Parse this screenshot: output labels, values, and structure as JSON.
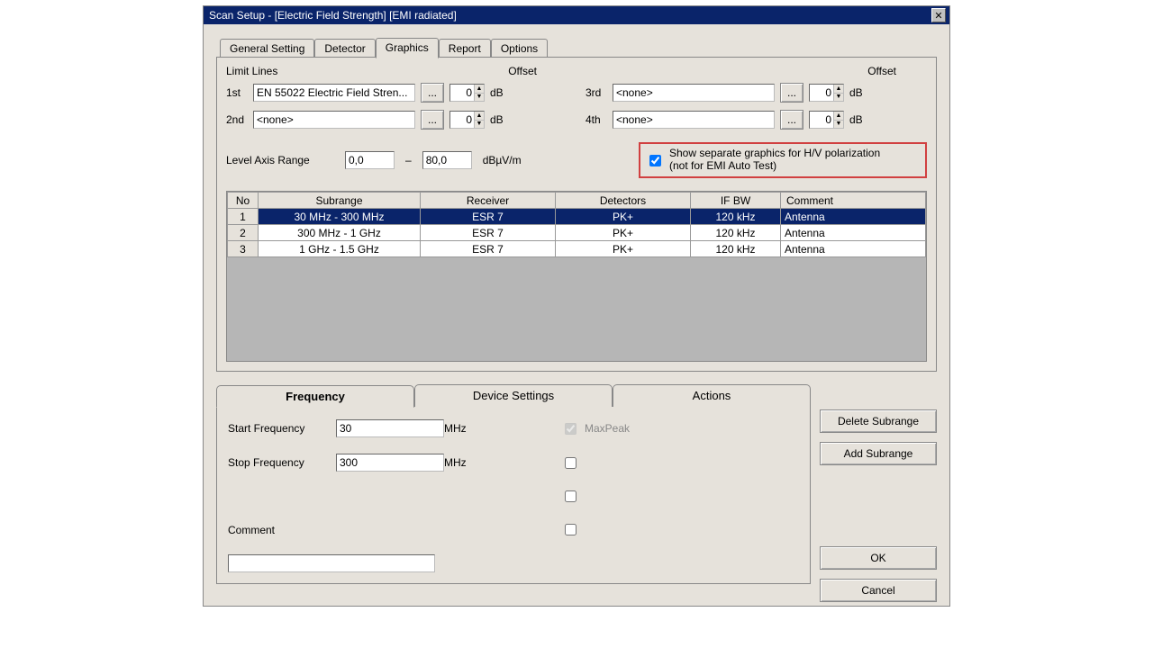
{
  "window": {
    "title": "Scan Setup - [Electric Field Strength] [EMI radiated]"
  },
  "tabs": {
    "general": "General Setting",
    "detector": "Detector",
    "graphics": "Graphics",
    "report": "Report",
    "options": "Options"
  },
  "limits": {
    "section": "Limit Lines",
    "offset_label": "Offset",
    "db": "dB",
    "row1_label": "1st",
    "row1_value": "EN 55022 Electric Field Stren...",
    "row1_offset": "0",
    "row2_label": "2nd",
    "row2_value": "<none>",
    "row2_offset": "0",
    "row3_label": "3rd",
    "row3_value": "<none>",
    "row3_offset": "0",
    "row4_label": "4th",
    "row4_value": "<none>",
    "row4_offset": "0"
  },
  "level_axis": {
    "label": "Level Axis Range",
    "from": "0,0",
    "dash": "–",
    "to": "80,0",
    "unit": "dBµV/m"
  },
  "hv": {
    "checked": true,
    "line1": "Show separate graphics for H/V polarization",
    "line2": "(not for EMI Auto Test)"
  },
  "table": {
    "headers": {
      "no": "No",
      "subrange": "Subrange",
      "receiver": "Receiver",
      "detectors": "Detectors",
      "ifbw": "IF BW",
      "comment": "Comment"
    },
    "rows": [
      {
        "no": "1",
        "subrange": "30 MHz - 300 MHz",
        "receiver": "ESR 7",
        "detectors": "PK+",
        "ifbw": "120 kHz",
        "comment": "Antenna"
      },
      {
        "no": "2",
        "subrange": "300 MHz - 1 GHz",
        "receiver": "ESR 7",
        "detectors": "PK+",
        "ifbw": "120 kHz",
        "comment": "Antenna"
      },
      {
        "no": "3",
        "subrange": "1 GHz - 1.5 GHz",
        "receiver": "ESR 7",
        "detectors": "PK+",
        "ifbw": "120 kHz",
        "comment": "Antenna"
      }
    ]
  },
  "lower_tabs": {
    "frequency": "Frequency",
    "device": "Device Settings",
    "actions": "Actions"
  },
  "freq": {
    "start_label": "Start Frequency",
    "start_value": "30",
    "stop_label": "Stop Frequency",
    "stop_value": "300",
    "unit": "MHz",
    "maxpeak": "MaxPeak",
    "comment_label": "Comment",
    "comment_value": ""
  },
  "buttons": {
    "ellipsis": "...",
    "delete_subrange": "Delete Subrange",
    "add_subrange": "Add Subrange",
    "ok": "OK",
    "cancel": "Cancel"
  }
}
